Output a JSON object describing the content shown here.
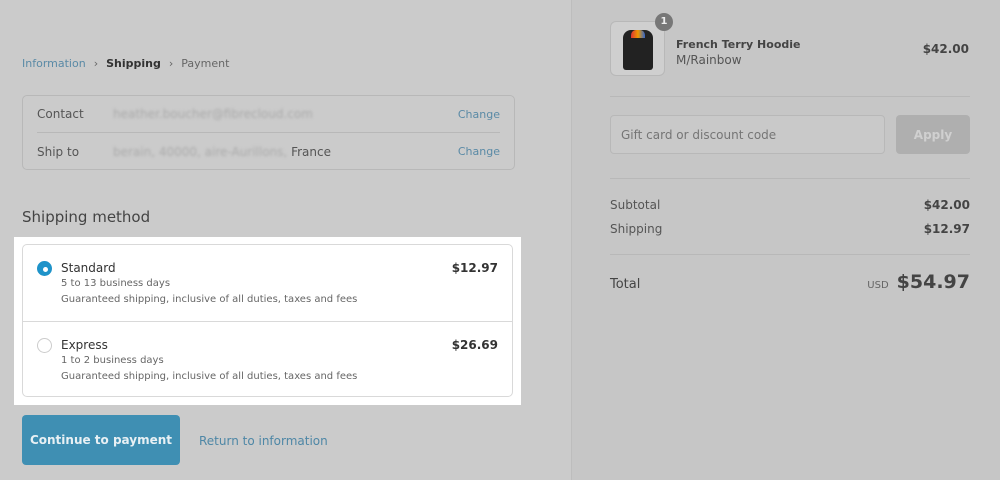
{
  "breadcrumb": {
    "items": [
      "Information",
      "Shipping",
      "Payment"
    ]
  },
  "info": {
    "contact_label": "Contact",
    "contact_value": "heather.boucher@fibrecloud.com",
    "ship_label": "Ship to",
    "ship_value_blurred": "berain, 40000, aire-Aurillons,",
    "ship_country": "France",
    "change": "Change"
  },
  "shipping": {
    "title": "Shipping method",
    "options": [
      {
        "name": "Standard",
        "days": "5 to 13 business days",
        "note": "Guaranteed shipping, inclusive of all duties, taxes and fees",
        "price": "$12.97",
        "selected": true
      },
      {
        "name": "Express",
        "days": "1 to 2 business days",
        "note": "Guaranteed shipping, inclusive of all duties, taxes and fees",
        "price": "$26.69",
        "selected": false
      }
    ]
  },
  "actions": {
    "continue": "Continue to payment",
    "return": "Return to information"
  },
  "cart": {
    "qty": "1",
    "name": "French Terry Hoodie",
    "variant": "M/Rainbow",
    "price": "$42.00"
  },
  "discount": {
    "placeholder": "Gift card or discount code",
    "apply": "Apply"
  },
  "summary": {
    "subtotal_label": "Subtotal",
    "subtotal": "$42.00",
    "shipping_label": "Shipping",
    "shipping": "$12.97",
    "total_label": "Total",
    "currency": "USD",
    "total": "$54.97"
  }
}
